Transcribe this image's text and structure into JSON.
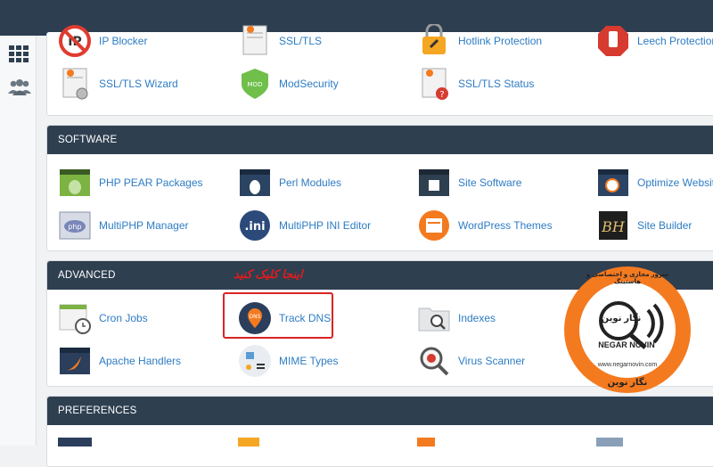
{
  "sidebar": {
    "icons": [
      "apps-grid-icon",
      "users-icon"
    ]
  },
  "security": {
    "items": [
      {
        "label": "IP Blocker",
        "icon": "ip-blocker-icon"
      },
      {
        "label": "SSL/TLS",
        "icon": "certificate-icon"
      },
      {
        "label": "Hotlink Protection",
        "icon": "lock-link-icon"
      },
      {
        "label": "Leech Protection",
        "icon": "hand-stop-icon"
      },
      {
        "label": "SSL/TLS Wizard",
        "icon": "certificate-wizard-icon"
      },
      {
        "label": "ModSecurity",
        "icon": "shield-mod-icon"
      },
      {
        "label": "SSL/TLS Status",
        "icon": "certificate-status-icon"
      }
    ]
  },
  "software": {
    "title": "SOFTWARE",
    "items": [
      {
        "label": "PHP PEAR Packages",
        "icon": "pear-icon"
      },
      {
        "label": "Perl Modules",
        "icon": "perl-onion-icon"
      },
      {
        "label": "Site Software",
        "icon": "puzzle-icon"
      },
      {
        "label": "Optimize Website",
        "icon": "optimize-icon"
      },
      {
        "label": "MultiPHP Manager",
        "icon": "php-icon"
      },
      {
        "label": "MultiPHP INI Editor",
        "icon": "ini-icon"
      },
      {
        "label": "WordPress Themes",
        "icon": "wordpress-themes-icon"
      },
      {
        "label": "Site Builder",
        "icon": "site-builder-icon"
      }
    ]
  },
  "advanced": {
    "title": "ADVANCED",
    "items": [
      {
        "label": "Cron Jobs",
        "icon": "calendar-clock-icon"
      },
      {
        "label": "Track DNS",
        "icon": "dns-pin-icon"
      },
      {
        "label": "Indexes",
        "icon": "folder-search-icon"
      },
      {
        "label": "Apache Handlers",
        "icon": "apache-feather-icon"
      },
      {
        "label": "MIME Types",
        "icon": "mime-icon"
      },
      {
        "label": "Virus Scanner",
        "icon": "virus-scanner-icon"
      }
    ]
  },
  "preferences": {
    "title": "PREFERENCES"
  },
  "annotation": {
    "text": "اینجا کلیک کنید"
  },
  "logo": {
    "name_fa": "نگار نوین",
    "name_en": "NEGAR NOVIN",
    "url": "www.negarnovin.com",
    "bottom_fa": "نگار نوین",
    "ring_text": "سرور مجازی و اختصاصی و هاستینگ"
  },
  "colors": {
    "header": "#2e3f50",
    "link": "#2d7cc4",
    "orange": "#f47a20",
    "red": "#e01c1c"
  }
}
